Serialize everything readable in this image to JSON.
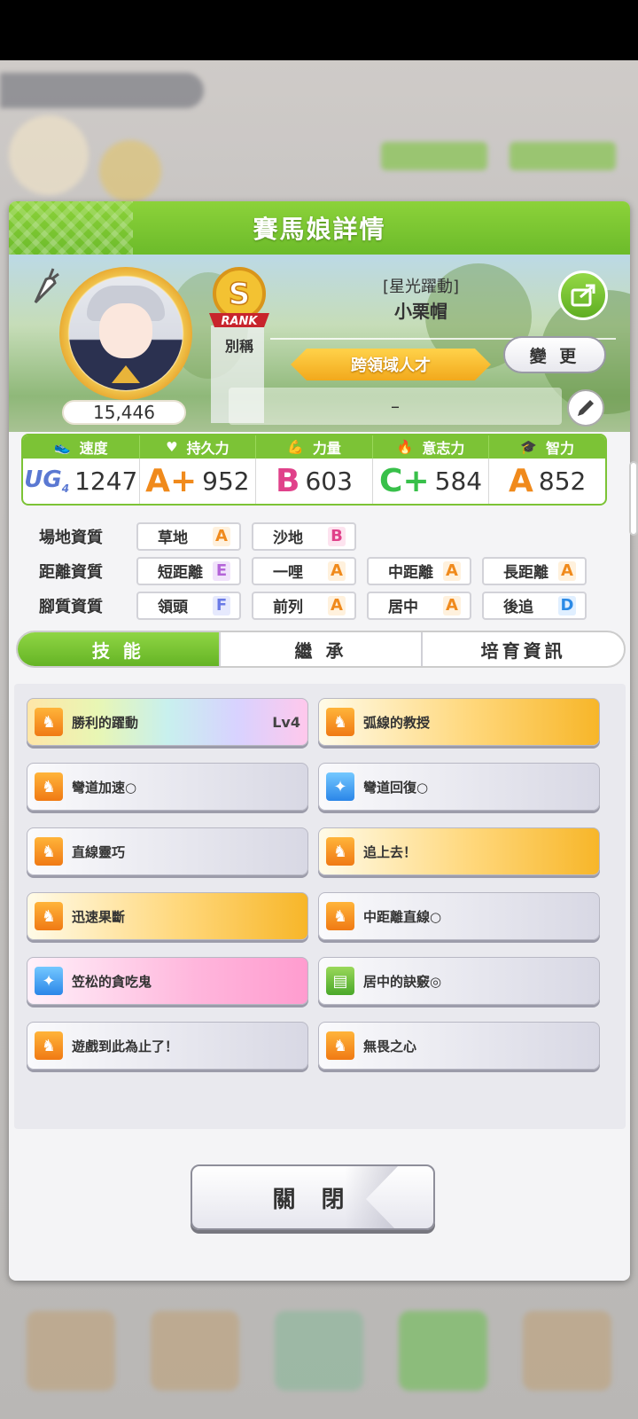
{
  "dialog": {
    "title": "賽馬娘詳情"
  },
  "profile": {
    "score": "15,446",
    "rank_badge": {
      "letter": "S",
      "text": "RANK"
    },
    "rank_label": "別稱",
    "title": "[星光躍動]",
    "name": "小栗帽",
    "epithet": "跨領域人才",
    "change_button": "變 更",
    "memo": "–"
  },
  "stats": {
    "headers": [
      {
        "label": "速度",
        "icon": "shoe-icon"
      },
      {
        "label": "持久力",
        "icon": "heart-icon"
      },
      {
        "label": "力量",
        "icon": "arm-icon"
      },
      {
        "label": "意志力",
        "icon": "flame-icon"
      },
      {
        "label": "智力",
        "icon": "graduation-cap-icon"
      }
    ],
    "values": [
      {
        "grade": "UG",
        "sub": "4",
        "value": "1247"
      },
      {
        "grade": "A+",
        "value": "952"
      },
      {
        "grade": "B",
        "value": "603"
      },
      {
        "grade": "C+",
        "value": "584"
      },
      {
        "grade": "A",
        "value": "852"
      }
    ]
  },
  "aptitude": {
    "rows": [
      {
        "label": "場地資質",
        "items": [
          {
            "name": "草地",
            "grade": "A"
          },
          {
            "name": "沙地",
            "grade": "B"
          }
        ]
      },
      {
        "label": "距離資質",
        "items": [
          {
            "name": "短距離",
            "grade": "E"
          },
          {
            "name": "一哩",
            "grade": "A"
          },
          {
            "name": "中距離",
            "grade": "A"
          },
          {
            "name": "長距離",
            "grade": "A"
          }
        ]
      },
      {
        "label": "腳質資質",
        "items": [
          {
            "name": "領頭",
            "grade": "F"
          },
          {
            "name": "前列",
            "grade": "A"
          },
          {
            "name": "居中",
            "grade": "A"
          },
          {
            "name": "後追",
            "grade": "D"
          }
        ]
      }
    ]
  },
  "tabs": [
    {
      "label": "技 能",
      "active": true
    },
    {
      "label": "繼 承",
      "active": false
    },
    {
      "label": "培育資訊",
      "active": false
    }
  ],
  "skills": [
    {
      "name": "勝利的躍動",
      "level": "Lv4",
      "style": "rainbow",
      "icon": "gold"
    },
    {
      "name": "弧線的教授",
      "style": "gold",
      "icon": "gold"
    },
    {
      "name": "彎道加速○",
      "style": "normal",
      "icon": "gold"
    },
    {
      "name": "彎道回復○",
      "style": "normal",
      "icon": "blue"
    },
    {
      "name": "直線靈巧",
      "style": "normal",
      "icon": "gold"
    },
    {
      "name": "追上去！",
      "style": "gold",
      "icon": "gold"
    },
    {
      "name": "迅速果斷",
      "style": "gold",
      "icon": "gold"
    },
    {
      "name": "中距離直線○",
      "style": "normal",
      "icon": "gold"
    },
    {
      "name": "笠松的貪吃鬼",
      "style": "pink",
      "icon": "blue"
    },
    {
      "name": "居中的訣竅◎",
      "style": "normal",
      "icon": "green"
    },
    {
      "name": "遊戲到此為止了！",
      "style": "normal",
      "icon": "gold"
    },
    {
      "name": "無畏之心",
      "style": "normal",
      "icon": "gold"
    }
  ],
  "close_button": "關 閉"
}
